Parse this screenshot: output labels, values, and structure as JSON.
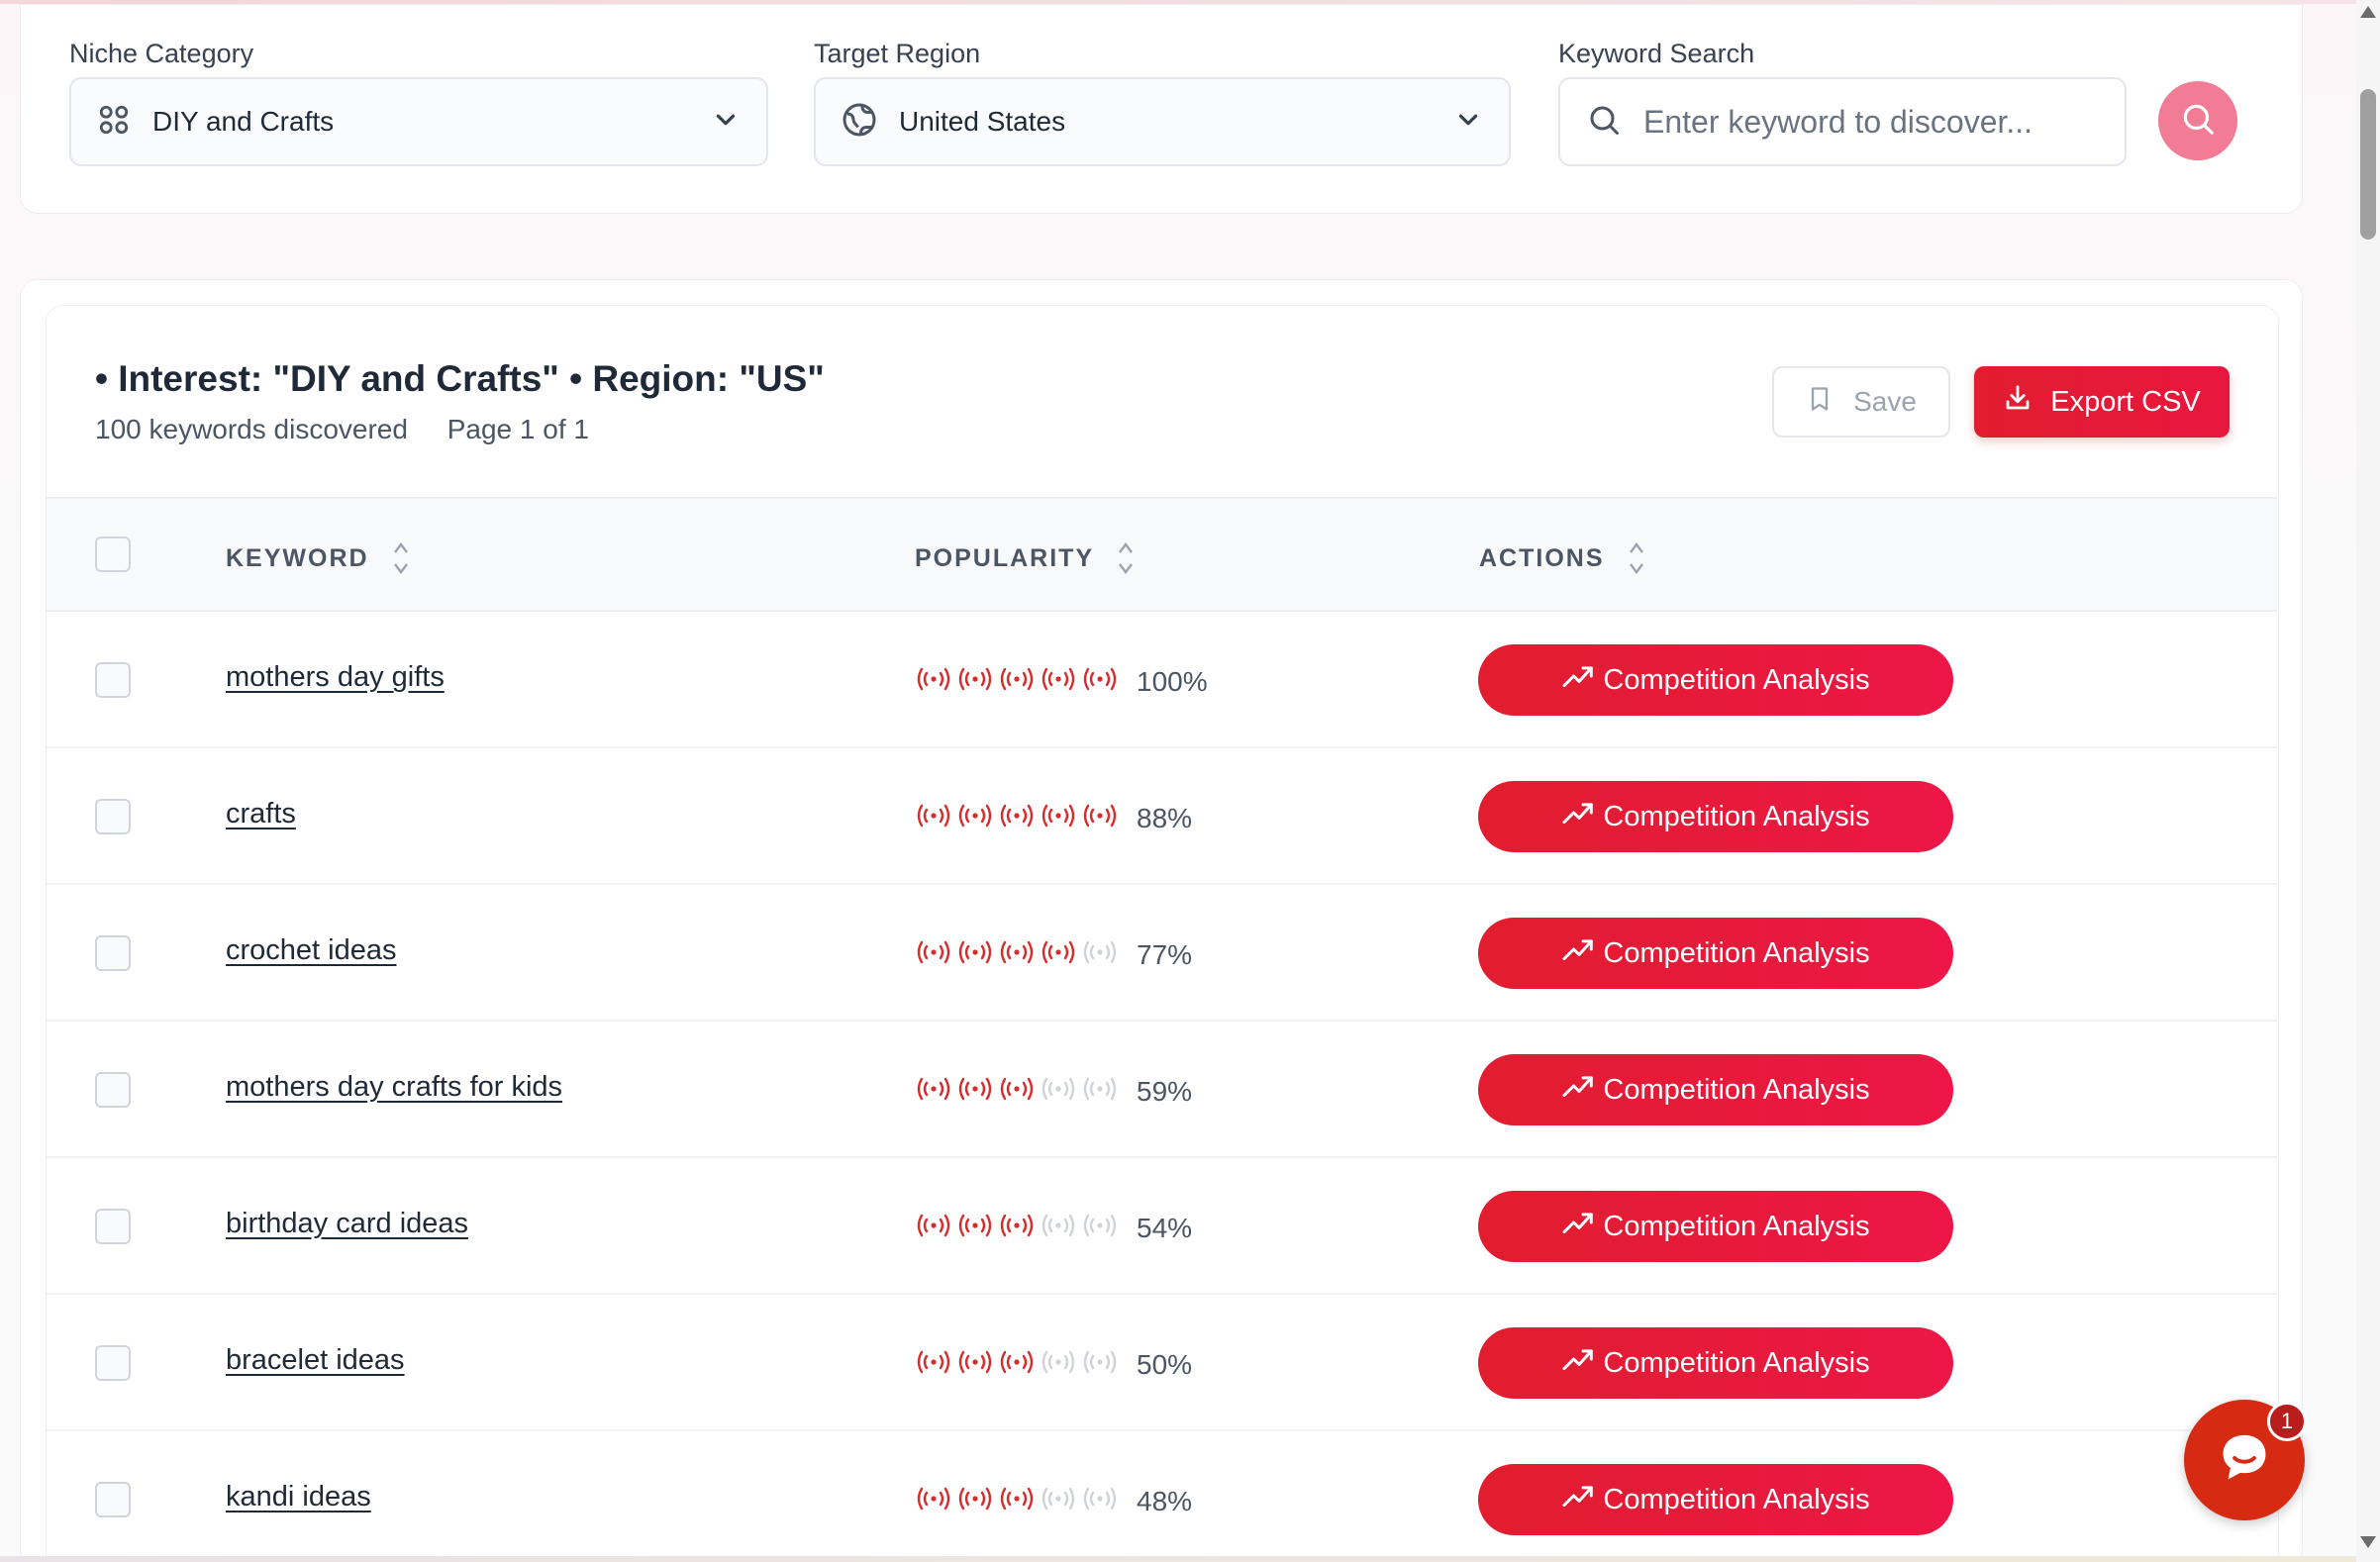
{
  "filters": {
    "niche": {
      "label": "Niche Category",
      "value": "DIY and Crafts"
    },
    "region": {
      "label": "Target Region",
      "value": "United States"
    },
    "search": {
      "label": "Keyword Search",
      "placeholder": "Enter keyword to discover..."
    }
  },
  "results": {
    "title": "• Interest: \"DIY and Crafts\" • Region: \"US\"",
    "count_text": "100 keywords discovered",
    "page_text": "Page 1 of 1",
    "save_label": "Save",
    "export_label": "Export CSV"
  },
  "table": {
    "headers": {
      "keyword": "KEYWORD",
      "popularity": "POPULARITY",
      "actions": "ACTIONS"
    },
    "action_label": "Competition Analysis",
    "rows": [
      {
        "keyword": "mothers day gifts",
        "popularity": "100%",
        "level": 5
      },
      {
        "keyword": "crafts",
        "popularity": "88%",
        "level": 5
      },
      {
        "keyword": "crochet ideas",
        "popularity": "77%",
        "level": 4
      },
      {
        "keyword": "mothers day crafts for kids",
        "popularity": "59%",
        "level": 3
      },
      {
        "keyword": "birthday card ideas",
        "popularity": "54%",
        "level": 3
      },
      {
        "keyword": "bracelet ideas",
        "popularity": "50%",
        "level": 3
      },
      {
        "keyword": "kandi ideas",
        "popularity": "48%",
        "level": 3
      }
    ]
  },
  "chat": {
    "badge": "1"
  },
  "colors": {
    "accent": "#e11d2f",
    "signal_on": "#d92b2b",
    "signal_off": "#cfd3d8"
  },
  "icons": [
    "grid-icon",
    "globe-icon",
    "chevron-down-icon",
    "search-icon",
    "bookmark-icon",
    "download-icon",
    "sort-icon",
    "signal-icon",
    "trending-up-icon",
    "chat-icon"
  ]
}
